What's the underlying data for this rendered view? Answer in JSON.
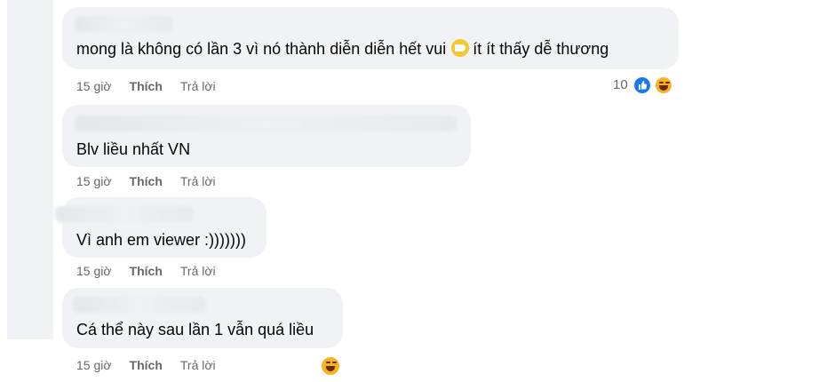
{
  "comments": [
    {
      "text": "mong là không có lần 3 vì nó thành diễn diễn hết vui",
      "emoji": "pacman-emoji",
      "text_after": "ít ít thấy dễ thương",
      "time": "15 giờ",
      "like": "Thích",
      "reply": "Trả lời",
      "reaction_count": "10",
      "reactions": [
        "like-icon",
        "haha-icon"
      ]
    },
    {
      "text": "Blv liều nhất VN",
      "time": "15 giờ",
      "like": "Thích",
      "reply": "Trả lời"
    },
    {
      "text": "Vì anh em viewer :)))))))",
      "time": "15 giờ",
      "like": "Thích",
      "reply": "Trả lời"
    },
    {
      "text": "Cá thể này sau lần 1 vẫn quá liều",
      "time": "15 giờ",
      "like": "Thích",
      "reply": "Trả lời",
      "reactions": [
        "haha-icon"
      ]
    }
  ],
  "colors": {
    "bubble": "#f0f2f5",
    "meta_text": "#65676b",
    "like_blue": "#1877f2",
    "haha_yellow": "#f7b125"
  }
}
